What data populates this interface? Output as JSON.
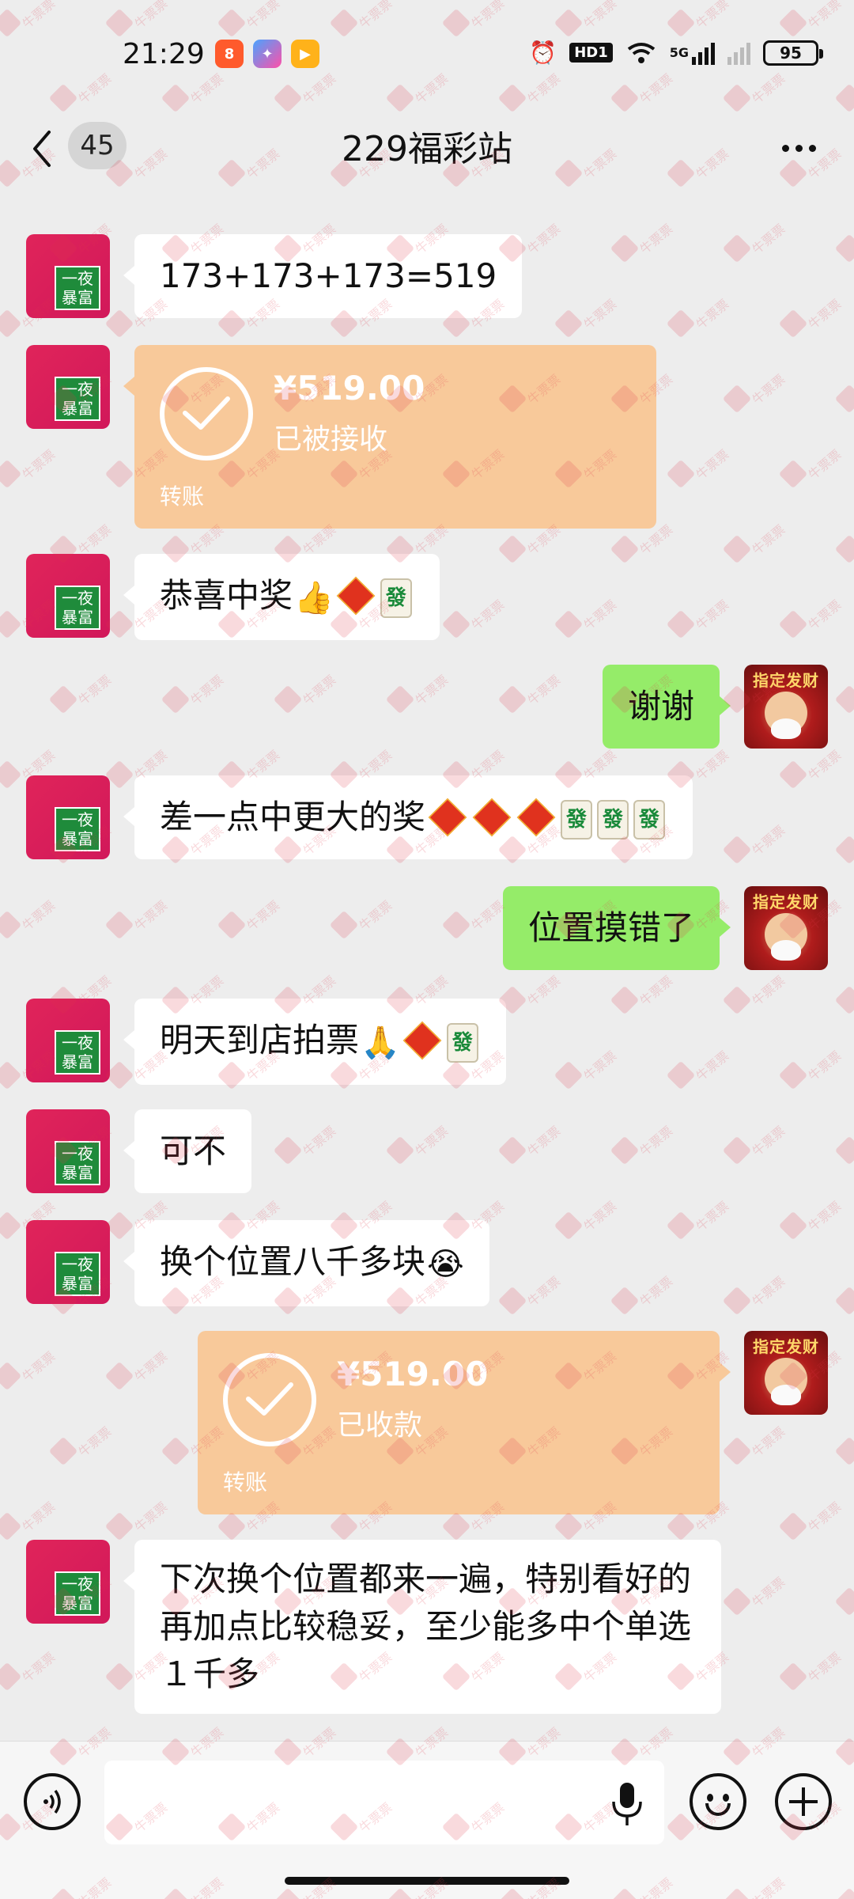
{
  "status_bar": {
    "time": "21:29",
    "battery": "95",
    "network": "5G",
    "hd_label": "HD1"
  },
  "header": {
    "unread_count": "45",
    "title": "229福彩站"
  },
  "messages": [
    {
      "side": "left",
      "type": "text",
      "text": "173+173+173=519"
    },
    {
      "side": "left",
      "type": "transfer",
      "amount": "¥519.00",
      "status": "已被接收",
      "kind": "转账"
    },
    {
      "side": "left",
      "type": "text",
      "text": "恭喜中奖",
      "emojis": [
        "thumbs-up",
        "fu",
        "fa"
      ]
    },
    {
      "side": "right",
      "type": "text",
      "text": "谢谢"
    },
    {
      "side": "left",
      "type": "text",
      "text": "差一点中更大的奖",
      "emojis": [
        "fu",
        "fu",
        "fu",
        "fa",
        "fa",
        "fa"
      ]
    },
    {
      "side": "right",
      "type": "text",
      "text": "位置摸错了"
    },
    {
      "side": "left",
      "type": "text",
      "text": "明天到店拍票",
      "emojis": [
        "pray",
        "fu",
        "fa"
      ]
    },
    {
      "side": "left",
      "type": "text",
      "text": "可不"
    },
    {
      "side": "left",
      "type": "text",
      "text": "换个位置八千多块",
      "emojis": [
        "crying"
      ]
    },
    {
      "side": "right",
      "type": "transfer",
      "amount": "¥519.00",
      "status": "已收款",
      "kind": "转账"
    },
    {
      "side": "left",
      "type": "text",
      "text": "下次换个位置都来一遍，特别看好的再加点比较稳妥，至少能多中个单选１千多"
    }
  ],
  "avatars": {
    "left_line1": "一夜",
    "left_line2": "暴富",
    "right_banner": "指定发财"
  },
  "emoji_glyphs": {
    "fa": "發",
    "thumbs": "👍",
    "pray": "🙏",
    "crying": "😭"
  },
  "watermark_text": "牛票票",
  "input": {
    "placeholder": ""
  },
  "colors": {
    "background": "#ededed",
    "bubble_self": "#95ec69",
    "bubble_other": "#ffffff",
    "transfer": "#f8c99a",
    "avatar_left": "#d91c5c",
    "avatar_badge": "#1f8b3b"
  }
}
